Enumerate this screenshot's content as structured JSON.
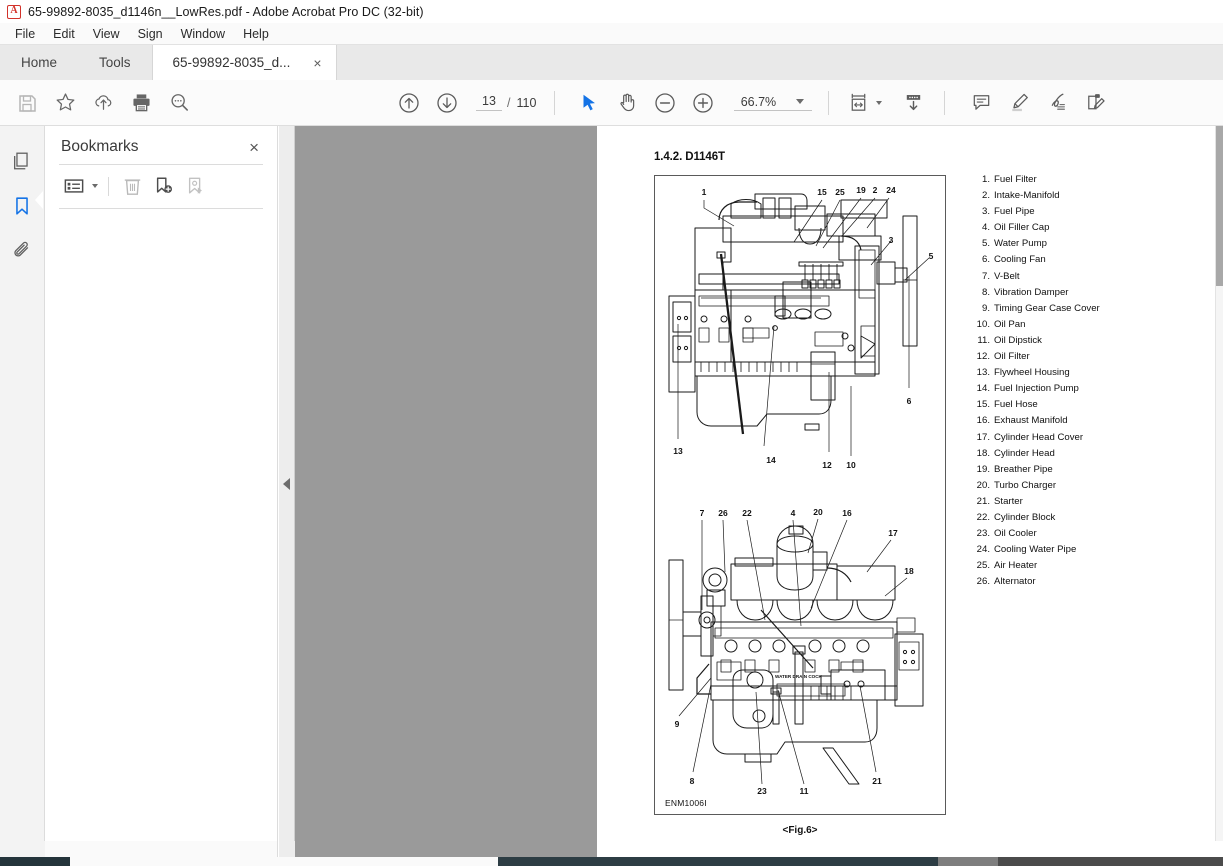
{
  "window": {
    "title": "65-99892-8035_d1146n__LowRes.pdf - Adobe Acrobat Pro DC (32-bit)",
    "logo_icon": "acrobat-logo-icon"
  },
  "menubar": {
    "items": [
      {
        "label": "File"
      },
      {
        "label": "Edit"
      },
      {
        "label": "View"
      },
      {
        "label": "Sign"
      },
      {
        "label": "Window"
      },
      {
        "label": "Help"
      }
    ]
  },
  "tabs": {
    "home": "Home",
    "tools": "Tools",
    "document": "65-99892-8035_d...",
    "close_glyph": "×"
  },
  "toolbar": {
    "left_tools": [
      {
        "name": "save-file-icon",
        "title": "Save file"
      },
      {
        "name": "star-icon",
        "title": "Add to favorites"
      },
      {
        "name": "upload-cloud-icon",
        "title": "Save to cloud"
      },
      {
        "name": "print-icon",
        "title": "Print file"
      },
      {
        "name": "search-icon",
        "title": "Find text"
      }
    ],
    "page_up_icon": "arrow-up-circle-icon",
    "page_down_icon": "arrow-down-circle-icon",
    "page_current": "13",
    "page_separator": "/",
    "page_total": "110",
    "select_tool_icon": "cursor-arrow-icon",
    "hand_tool_icon": "hand-icon",
    "zoom_out_icon": "minus-circle-icon",
    "zoom_in_icon": "plus-circle-icon",
    "zoom_value": "66.7%",
    "zoom_dropdown_icon": "chevron-down-icon",
    "fit_width_icon": "fit-page-width-icon",
    "fit_width_dropdown_icon": "chevron-down-icon",
    "scroll_mode_icon": "scroll-page-down-icon",
    "right_tools": [
      {
        "name": "comment-icon",
        "title": "Add comment"
      },
      {
        "name": "highlight-pen-icon",
        "title": "Highlight text"
      },
      {
        "name": "sign-icon",
        "title": "Fill and sign"
      },
      {
        "name": "edit-pdf-icon",
        "title": "Edit PDF"
      }
    ]
  },
  "rail": {
    "items": [
      {
        "name": "page-thumbnails-icon",
        "label": "Page Thumbnails",
        "active": "false"
      },
      {
        "name": "bookmarks-icon",
        "label": "Bookmarks",
        "active": "true"
      },
      {
        "name": "attachments-icon",
        "label": "Attachments",
        "active": "false"
      }
    ]
  },
  "bookmarks_panel": {
    "title": "Bookmarks",
    "close_glyph": "×",
    "tools": [
      {
        "name": "bookmark-options-icon",
        "label": "Options"
      },
      {
        "name": "delete-bookmark-icon",
        "label": "Delete Bookmark"
      },
      {
        "name": "new-bookmark-icon",
        "label": "New Bookmark"
      },
      {
        "name": "bookmark-properties-icon",
        "label": "Bookmark Properties"
      }
    ],
    "list": []
  },
  "collapse_handle": {
    "icon": "collapse-left-arrow-icon"
  },
  "document": {
    "section_heading": "1.4.2. D1146T",
    "figure_code": "ENM1006I",
    "figure_caption": "<Fig.6>",
    "parts": [
      {
        "no": "1.",
        "name": "Fuel Filter"
      },
      {
        "no": "2.",
        "name": "Intake-Manifold"
      },
      {
        "no": "3.",
        "name": "Fuel Pipe"
      },
      {
        "no": "4.",
        "name": "Oil Filler Cap"
      },
      {
        "no": "5.",
        "name": "Water Pump"
      },
      {
        "no": "6.",
        "name": "Cooling Fan"
      },
      {
        "no": "7.",
        "name": "V-Belt"
      },
      {
        "no": "8.",
        "name": "Vibration Damper"
      },
      {
        "no": "9.",
        "name": "Timing Gear Case Cover"
      },
      {
        "no": "10.",
        "name": "Oil Pan"
      },
      {
        "no": "11.",
        "name": "Oil Dipstick"
      },
      {
        "no": "12.",
        "name": "Oil Filter"
      },
      {
        "no": "13.",
        "name": "Flywheel Housing"
      },
      {
        "no": "14.",
        "name": "Fuel Injection Pump"
      },
      {
        "no": "15.",
        "name": "Fuel Hose"
      },
      {
        "no": "16.",
        "name": "Exhaust Manifold"
      },
      {
        "no": "17.",
        "name": "Cylinder Head Cover"
      },
      {
        "no": "18.",
        "name": "Cylinder Head"
      },
      {
        "no": "19.",
        "name": "Breather Pipe"
      },
      {
        "no": "20.",
        "name": "Turbo Charger"
      },
      {
        "no": "21.",
        "name": "Starter"
      },
      {
        "no": "22.",
        "name": "Cylinder Block"
      },
      {
        "no": "23.",
        "name": "Oil Cooler"
      },
      {
        "no": "24.",
        "name": "Cooling Water Pipe"
      },
      {
        "no": "25.",
        "name": "Air Heater"
      },
      {
        "no": "26.",
        "name": "Alternator"
      }
    ],
    "figure_top_callouts": [
      "1",
      "15",
      "25",
      "19",
      "2",
      "24",
      "3",
      "5",
      "6",
      "13",
      "14",
      "12",
      "10"
    ],
    "figure_bottom_callouts": [
      "7",
      "26",
      "22",
      "4",
      "20",
      "16",
      "17",
      "18",
      "9",
      "8",
      "23",
      "11",
      "21"
    ],
    "figure_bottom_label": "WATER DRAIN COCK"
  },
  "colors": {
    "accent_blue": "#1473e6",
    "acrobat_red": "#d2322a",
    "canvas_gray": "#9a9a9a",
    "toolbar_bg": "#fbfbfb"
  }
}
